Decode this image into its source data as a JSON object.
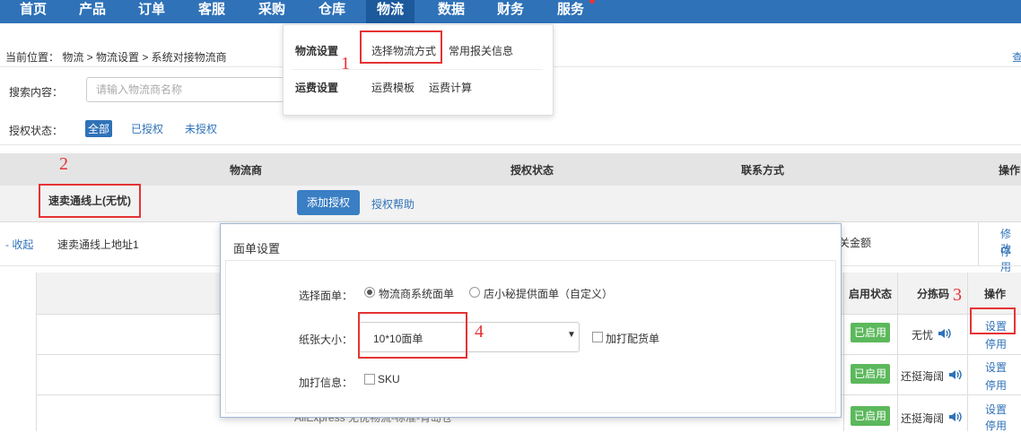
{
  "nav": {
    "items": [
      "首页",
      "产品",
      "订单",
      "客服",
      "采购",
      "仓库",
      "物流",
      "数据",
      "财务",
      "服务"
    ],
    "active": "物流"
  },
  "dropdown": {
    "logistics_settings": "物流设置",
    "choose_method": "选择物流方式",
    "customs_info": "常用报关信息",
    "freight_settings": "运费设置",
    "freight_template": "运费模板",
    "freight_calc": "运费计算"
  },
  "breadcrumb": "当前位置： 物流 > 物流设置 > 系统对接物流商",
  "topright": "查",
  "search": {
    "label": "搜索内容：",
    "placeholder": "请输入物流商名称"
  },
  "auth_filter": {
    "label": "授权状态：",
    "options": [
      "全部",
      "已授权",
      "未授权"
    ]
  },
  "table_header": [
    "物流商",
    "授权状态",
    "联系方式",
    "操作"
  ],
  "carrier": {
    "name": "速卖通线上(无忧)",
    "add_auth": "添加授权",
    "help": "授权帮助"
  },
  "address_row": {
    "collapse": "- 收起",
    "name": "速卖通线上地址1",
    "right_text": "关金额",
    "modify": "修改",
    "disable": "停用"
  },
  "sub_header": {
    "status": "启用状态",
    "code": "分拣码",
    "action": "操作"
  },
  "sub_rows": [
    {
      "status": "已启用",
      "code": "无忧",
      "set": "设置",
      "disable": "停用"
    },
    {
      "status": "已启用",
      "code": "还挺海阔",
      "set": "设置",
      "disable": "停用"
    },
    {
      "status": "已启用",
      "code": "还挺海阔",
      "set": "设置",
      "disable": "停用"
    }
  ],
  "bottom_text": "AliExpress 无忧物流-标准-青岛仓",
  "modal": {
    "title": "面单设置",
    "choose_label": "选择面单：",
    "option_system": "物流商系统面单",
    "option_custom": "店小秘提供面单（自定义）",
    "paper_label": "纸张大小：",
    "paper_value": "10*10面单",
    "print_goods": "加打配货单",
    "print_info_label": "加打信息：",
    "sku": "SKU"
  },
  "annotations": [
    "1",
    "2",
    "3",
    "4"
  ],
  "colors": {
    "nav": "#2f72b8",
    "accent_red": "#e53333",
    "badge_green": "#5cb85c"
  }
}
